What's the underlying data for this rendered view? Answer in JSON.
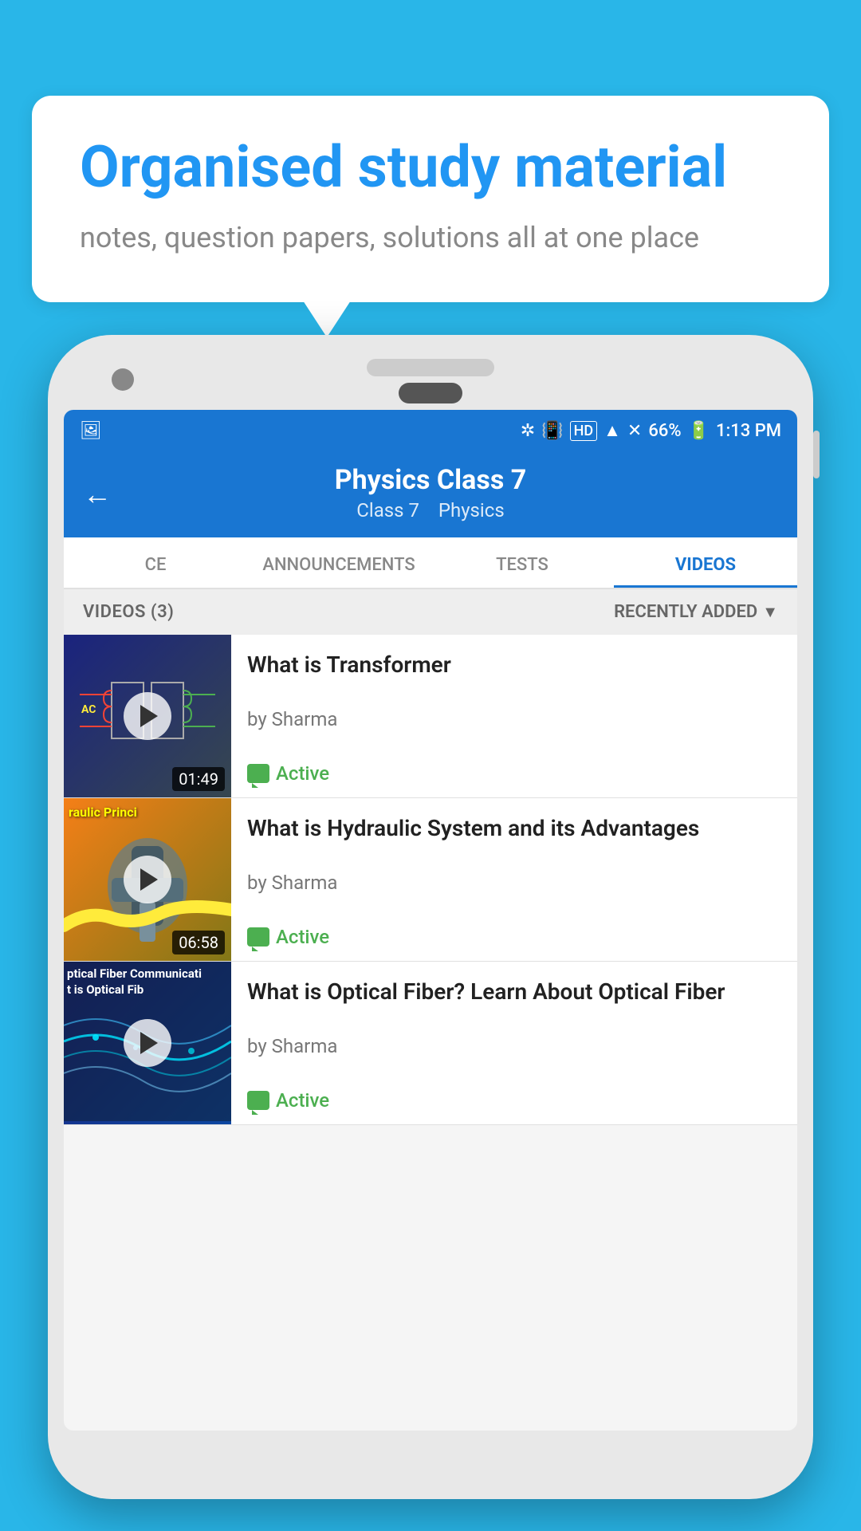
{
  "page": {
    "background_color": "#29b6e8"
  },
  "speech_bubble": {
    "headline": "Organised study material",
    "subtext": "notes, question papers, solutions all at one place"
  },
  "status_bar": {
    "time": "1:13 PM",
    "battery": "66%",
    "signal_text": "HD"
  },
  "app_header": {
    "back_label": "←",
    "title": "Physics Class 7",
    "subtitle_class": "Class 7",
    "subtitle_subject": "Physics"
  },
  "tabs": [
    {
      "label": "CE",
      "active": false
    },
    {
      "label": "ANNOUNCEMENTS",
      "active": false
    },
    {
      "label": "TESTS",
      "active": false
    },
    {
      "label": "VIDEOS",
      "active": true
    }
  ],
  "videos_section": {
    "count_label": "VIDEOS (3)",
    "sort_label": "RECENTLY ADDED"
  },
  "videos": [
    {
      "title": "What is  Transformer",
      "author": "by Sharma",
      "status": "Active",
      "duration": "01:49",
      "thumb_bg": "thumb-1"
    },
    {
      "title": "What is Hydraulic System and its Advantages",
      "author": "by Sharma",
      "status": "Active",
      "duration": "06:58",
      "thumb_bg": "thumb-2",
      "thumb_text": "raulic Princi"
    },
    {
      "title": "What is Optical Fiber? Learn About Optical Fiber",
      "author": "by Sharma",
      "status": "Active",
      "duration": "",
      "thumb_bg": "thumb-3",
      "thumb_text": "ptical Fiber Communicati\nt is Optical Fib"
    }
  ]
}
